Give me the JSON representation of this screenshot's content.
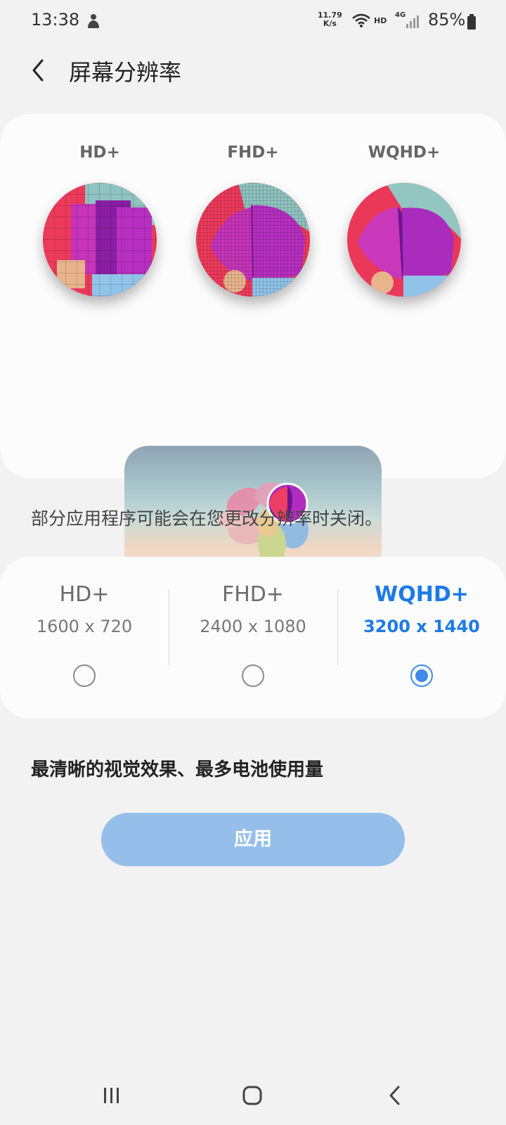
{
  "status_bar": {
    "time": "13:38",
    "net_speed_value": "11.79",
    "net_speed_unit": "K/s",
    "hd_label": "HD",
    "network_label": "4G",
    "battery": "85%"
  },
  "header": {
    "title": "屏幕分辨率"
  },
  "preview": {
    "labels": [
      "HD+",
      "FHD+",
      "WQHD+"
    ]
  },
  "note": "部分应用程序可能会在您更改分辨率时关闭。",
  "options": [
    {
      "name": "HD+",
      "dims": "1600 x 720",
      "selected": false
    },
    {
      "name": "FHD+",
      "dims": "2400 x 1080",
      "selected": false
    },
    {
      "name": "WQHD+",
      "dims": "3200 x 1440",
      "selected": true
    }
  ],
  "effect": "最清晰的视觉效果、最多电池使用量",
  "apply_label": "应用",
  "colors": {
    "accent": "#1c7ae6",
    "apply_button": "#95bfea",
    "background": "#f2f2f2"
  },
  "nav": {
    "recent_icon": "recent-apps-icon",
    "home_icon": "home-icon",
    "back_icon": "back-icon"
  }
}
